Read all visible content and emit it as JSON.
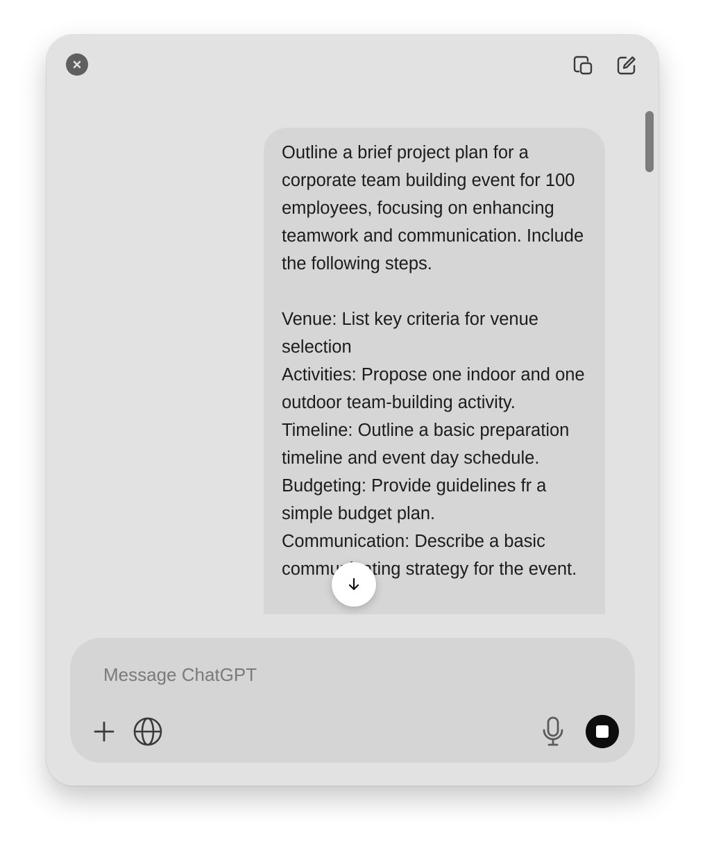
{
  "window": {
    "icons": {
      "close": "close-icon",
      "popout": "popout-window-icon",
      "new_chat": "new-chat-icon"
    }
  },
  "conversation": {
    "user_message": "Outline a brief project plan for a corporate team building event for 100 employees, focusing on enhancing teamwork and communication. Include the following steps.\n\nVenue: List key criteria for venue selection\nActivities: Propose one indoor and one outdoor team-building activity.\nTimeline: Outline a basic preparation timeline and event day schedule.\nBudgeting: Provide guidelines fr a simple budget plan.\nCommunication: Describe a basic communicating strategy for the event."
  },
  "composer": {
    "placeholder": "Message ChatGPT",
    "value": "",
    "icons": {
      "attach": "plus-icon",
      "search": "globe-icon",
      "voice": "microphone-icon",
      "stop": "stop-icon",
      "scroll_down": "arrow-down-icon"
    }
  },
  "colors": {
    "window_bg": "#e2e2e2",
    "bubble_bg": "#d6d6d6",
    "composer_bg": "#d5d5d5",
    "stop_button": "#0d0d0d",
    "close_button": "#5f5f5f"
  }
}
